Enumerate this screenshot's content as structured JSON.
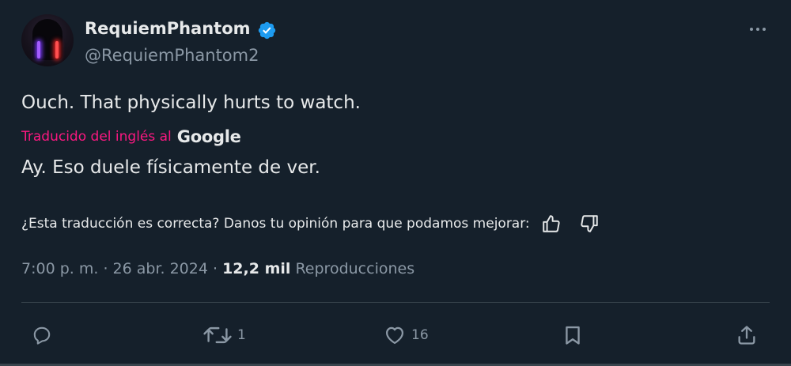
{
  "tweet": {
    "author": {
      "display_name": "RequiemPhantom",
      "handle": "@RequiemPhantom2",
      "verified": true,
      "avatar_icon": "hooded-figure-with-lightsabers-avatar"
    },
    "original_text": "Ouch. That physically hurts to watch.",
    "translation": {
      "label": "Traducido del inglés al",
      "provider": "Google",
      "text": "Ay. Eso duele físicamente de ver."
    },
    "feedback": {
      "question": "¿Esta traducción es correcta? Danos tu opinión para que podamos mejorar:",
      "thumbs_up_icon": "thumbs-up-icon",
      "thumbs_down_icon": "thumbs-down-icon"
    },
    "meta": {
      "time": "7:00 p. m.",
      "separator": " · ",
      "date": "26 abr. 2024",
      "views_count": "12,2 mil",
      "views_label": "Reproducciones"
    },
    "actions": {
      "reply": {
        "icon": "reply-icon",
        "count": ""
      },
      "retweet": {
        "icon": "retweet-icon",
        "count": "1"
      },
      "like": {
        "icon": "heart-icon",
        "count": "16"
      },
      "bookmark": {
        "icon": "bookmark-icon",
        "count": ""
      },
      "share": {
        "icon": "share-icon",
        "count": ""
      }
    }
  },
  "colors": {
    "background": "#15202b",
    "text_primary": "#e7e9ea",
    "text_secondary": "#8b98a5",
    "verified_blue": "#1d9bf0",
    "translation_pink": "#f91880",
    "divider": "#38444d"
  }
}
